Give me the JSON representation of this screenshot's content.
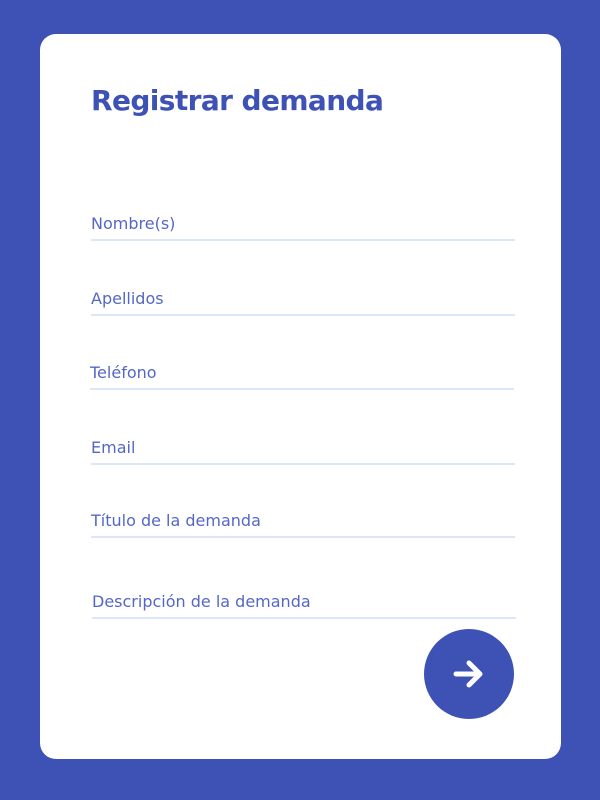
{
  "form": {
    "title": "Registrar demanda",
    "fields": [
      {
        "name": "nombres",
        "value": "",
        "placeholder": "Nombre(s)"
      },
      {
        "name": "apellidos",
        "value": "",
        "placeholder": "Apellidos"
      },
      {
        "name": "telefono",
        "value": "",
        "placeholder": "Teléfono"
      },
      {
        "name": "email",
        "value": "",
        "placeholder": "Email"
      },
      {
        "name": "titulo",
        "value": "",
        "placeholder": "Título de la demanda"
      },
      {
        "name": "descripcion",
        "value": "",
        "placeholder": "Descripción de la demanda"
      }
    ],
    "submit": {
      "icon": "arrow-right-icon"
    }
  },
  "colors": {
    "background": "#3d52b4",
    "card": "#ffffff",
    "accent": "#3d52b4",
    "field_text": "#5567c5",
    "field_underline": "#dbe6f8"
  }
}
